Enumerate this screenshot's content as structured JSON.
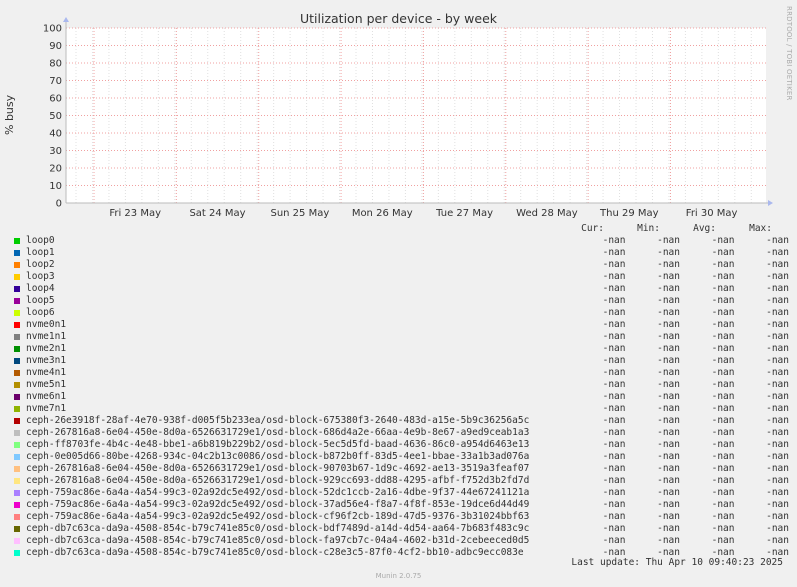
{
  "chart_data": {
    "type": "line",
    "title": "Utilization per device - by week",
    "ylabel": "% busy",
    "ylim": [
      0,
      100
    ],
    "yticks": [
      "0",
      "10",
      "20",
      "30",
      "40",
      "50",
      "60",
      "70",
      "80",
      "90",
      "100"
    ],
    "x_ticks": [
      "Fri 23 May",
      "Sat 24 May",
      "Sun 25 May",
      "Mon 26 May",
      "Tue 27 May",
      "Wed 28 May",
      "Thu 29 May",
      "Fri 30 May"
    ],
    "grid": true,
    "series_values": "-nan"
  },
  "vendor": "RRDTOOL / TOBI OETIKER",
  "legend": {
    "headers": [
      "Cur:",
      "Min:",
      "Avg:",
      "Max:"
    ],
    "items": [
      {
        "name": "loop0",
        "color": "#00cc00",
        "cur": "-nan",
        "min": "-nan",
        "avg": "-nan",
        "max": "-nan"
      },
      {
        "name": "loop1",
        "color": "#0066b3",
        "cur": "-nan",
        "min": "-nan",
        "avg": "-nan",
        "max": "-nan"
      },
      {
        "name": "loop2",
        "color": "#ff8000",
        "cur": "-nan",
        "min": "-nan",
        "avg": "-nan",
        "max": "-nan"
      },
      {
        "name": "loop3",
        "color": "#ffcc00",
        "cur": "-nan",
        "min": "-nan",
        "avg": "-nan",
        "max": "-nan"
      },
      {
        "name": "loop4",
        "color": "#330099",
        "cur": "-nan",
        "min": "-nan",
        "avg": "-nan",
        "max": "-nan"
      },
      {
        "name": "loop5",
        "color": "#990099",
        "cur": "-nan",
        "min": "-nan",
        "avg": "-nan",
        "max": "-nan"
      },
      {
        "name": "loop6",
        "color": "#ccff00",
        "cur": "-nan",
        "min": "-nan",
        "avg": "-nan",
        "max": "-nan"
      },
      {
        "name": "nvme0n1",
        "color": "#ff0000",
        "cur": "-nan",
        "min": "-nan",
        "avg": "-nan",
        "max": "-nan"
      },
      {
        "name": "nvme1n1",
        "color": "#808080",
        "cur": "-nan",
        "min": "-nan",
        "avg": "-nan",
        "max": "-nan"
      },
      {
        "name": "nvme2n1",
        "color": "#008f00",
        "cur": "-nan",
        "min": "-nan",
        "avg": "-nan",
        "max": "-nan"
      },
      {
        "name": "nvme3n1",
        "color": "#00487d",
        "cur": "-nan",
        "min": "-nan",
        "avg": "-nan",
        "max": "-nan"
      },
      {
        "name": "nvme4n1",
        "color": "#b35a00",
        "cur": "-nan",
        "min": "-nan",
        "avg": "-nan",
        "max": "-nan"
      },
      {
        "name": "nvme5n1",
        "color": "#b38f00",
        "cur": "-nan",
        "min": "-nan",
        "avg": "-nan",
        "max": "-nan"
      },
      {
        "name": "nvme6n1",
        "color": "#6b006b",
        "cur": "-nan",
        "min": "-nan",
        "avg": "-nan",
        "max": "-nan"
      },
      {
        "name": "nvme7n1",
        "color": "#8fb300",
        "cur": "-nan",
        "min": "-nan",
        "avg": "-nan",
        "max": "-nan"
      },
      {
        "name": "ceph-26e3918f-28af-4e70-938f-d005f5b233ea/osd-block-675380f3-2640-483d-a15e-5b9c36256a5c",
        "color": "#b30000",
        "cur": "-nan",
        "min": "-nan",
        "avg": "-nan",
        "max": "-nan"
      },
      {
        "name": "ceph-267816a8-6e04-450e-8d0a-6526631729e1/osd-block-686d4a2e-66aa-4e9b-8e67-a9ed9ceab1a3",
        "color": "#bebebe",
        "cur": "-nan",
        "min": "-nan",
        "avg": "-nan",
        "max": "-nan"
      },
      {
        "name": "ceph-ff8703fe-4b4c-4e48-bbe1-a6b819b229b2/osd-block-5ec5d5fd-baad-4636-86c0-a954d6463e13",
        "color": "#80ff80",
        "cur": "-nan",
        "min": "-nan",
        "avg": "-nan",
        "max": "-nan"
      },
      {
        "name": "ceph-0e005d66-80be-4268-934c-04c2b13c0086/osd-block-b872b0ff-83d5-4ee1-bbae-33a1b3ad076a",
        "color": "#80c9ff",
        "cur": "-nan",
        "min": "-nan",
        "avg": "-nan",
        "max": "-nan"
      },
      {
        "name": "ceph-267816a8-6e04-450e-8d0a-6526631729e1/osd-block-90703b67-1d9c-4692-ae13-3519a3feaf07",
        "color": "#ffc080",
        "cur": "-nan",
        "min": "-nan",
        "avg": "-nan",
        "max": "-nan"
      },
      {
        "name": "ceph-267816a8-6e04-450e-8d0a-6526631729e1/osd-block-929cc693-dd88-4295-afbf-f752d3b2fd7d",
        "color": "#ffe680",
        "cur": "-nan",
        "min": "-nan",
        "avg": "-nan",
        "max": "-nan"
      },
      {
        "name": "ceph-759ac86e-6a4a-4a54-99c3-02a92dc5e492/osd-block-52dc1ccb-2a16-4dbe-9f37-44e67241121a",
        "color": "#aa80ff",
        "cur": "-nan",
        "min": "-nan",
        "avg": "-nan",
        "max": "-nan"
      },
      {
        "name": "ceph-759ac86e-6a4a-4a54-99c3-02a92dc5e492/osd-block-37ad56e4-f8a7-4f8f-853e-19dce6d44d49",
        "color": "#ee00cc",
        "cur": "-nan",
        "min": "-nan",
        "avg": "-nan",
        "max": "-nan"
      },
      {
        "name": "ceph-759ac86e-6a4a-4a54-99c3-02a92dc5e492/osd-block-cf96f2cb-189d-47d5-9376-3b31024bbf63",
        "color": "#ff8080",
        "cur": "-nan",
        "min": "-nan",
        "avg": "-nan",
        "max": "-nan"
      },
      {
        "name": "ceph-db7c63ca-da9a-4508-854c-b79c741e85c0/osd-block-bdf7489d-a14d-4d54-aa64-7b683f483c9c",
        "color": "#666600",
        "cur": "-nan",
        "min": "-nan",
        "avg": "-nan",
        "max": "-nan"
      },
      {
        "name": "ceph-db7c63ca-da9a-4508-854c-b79c741e85c0/osd-block-fa97cb7c-04a4-4602-b31d-2cebeeced0d5",
        "color": "#ffbfff",
        "cur": "-nan",
        "min": "-nan",
        "avg": "-nan",
        "max": "-nan"
      },
      {
        "name": "ceph-db7c63ca-da9a-4508-854c-b79c741e85c0/osd-block-c28e3c5-87f0-4cf2-bb10-adbc9ecc083e",
        "color": "#00ffcc",
        "cur": "-nan",
        "min": "-nan",
        "avg": "-nan",
        "max": "-nan"
      }
    ]
  },
  "footer": "Last update: Thu Apr 10 09:40:23 2025",
  "munin": "Munin 2.0.75"
}
